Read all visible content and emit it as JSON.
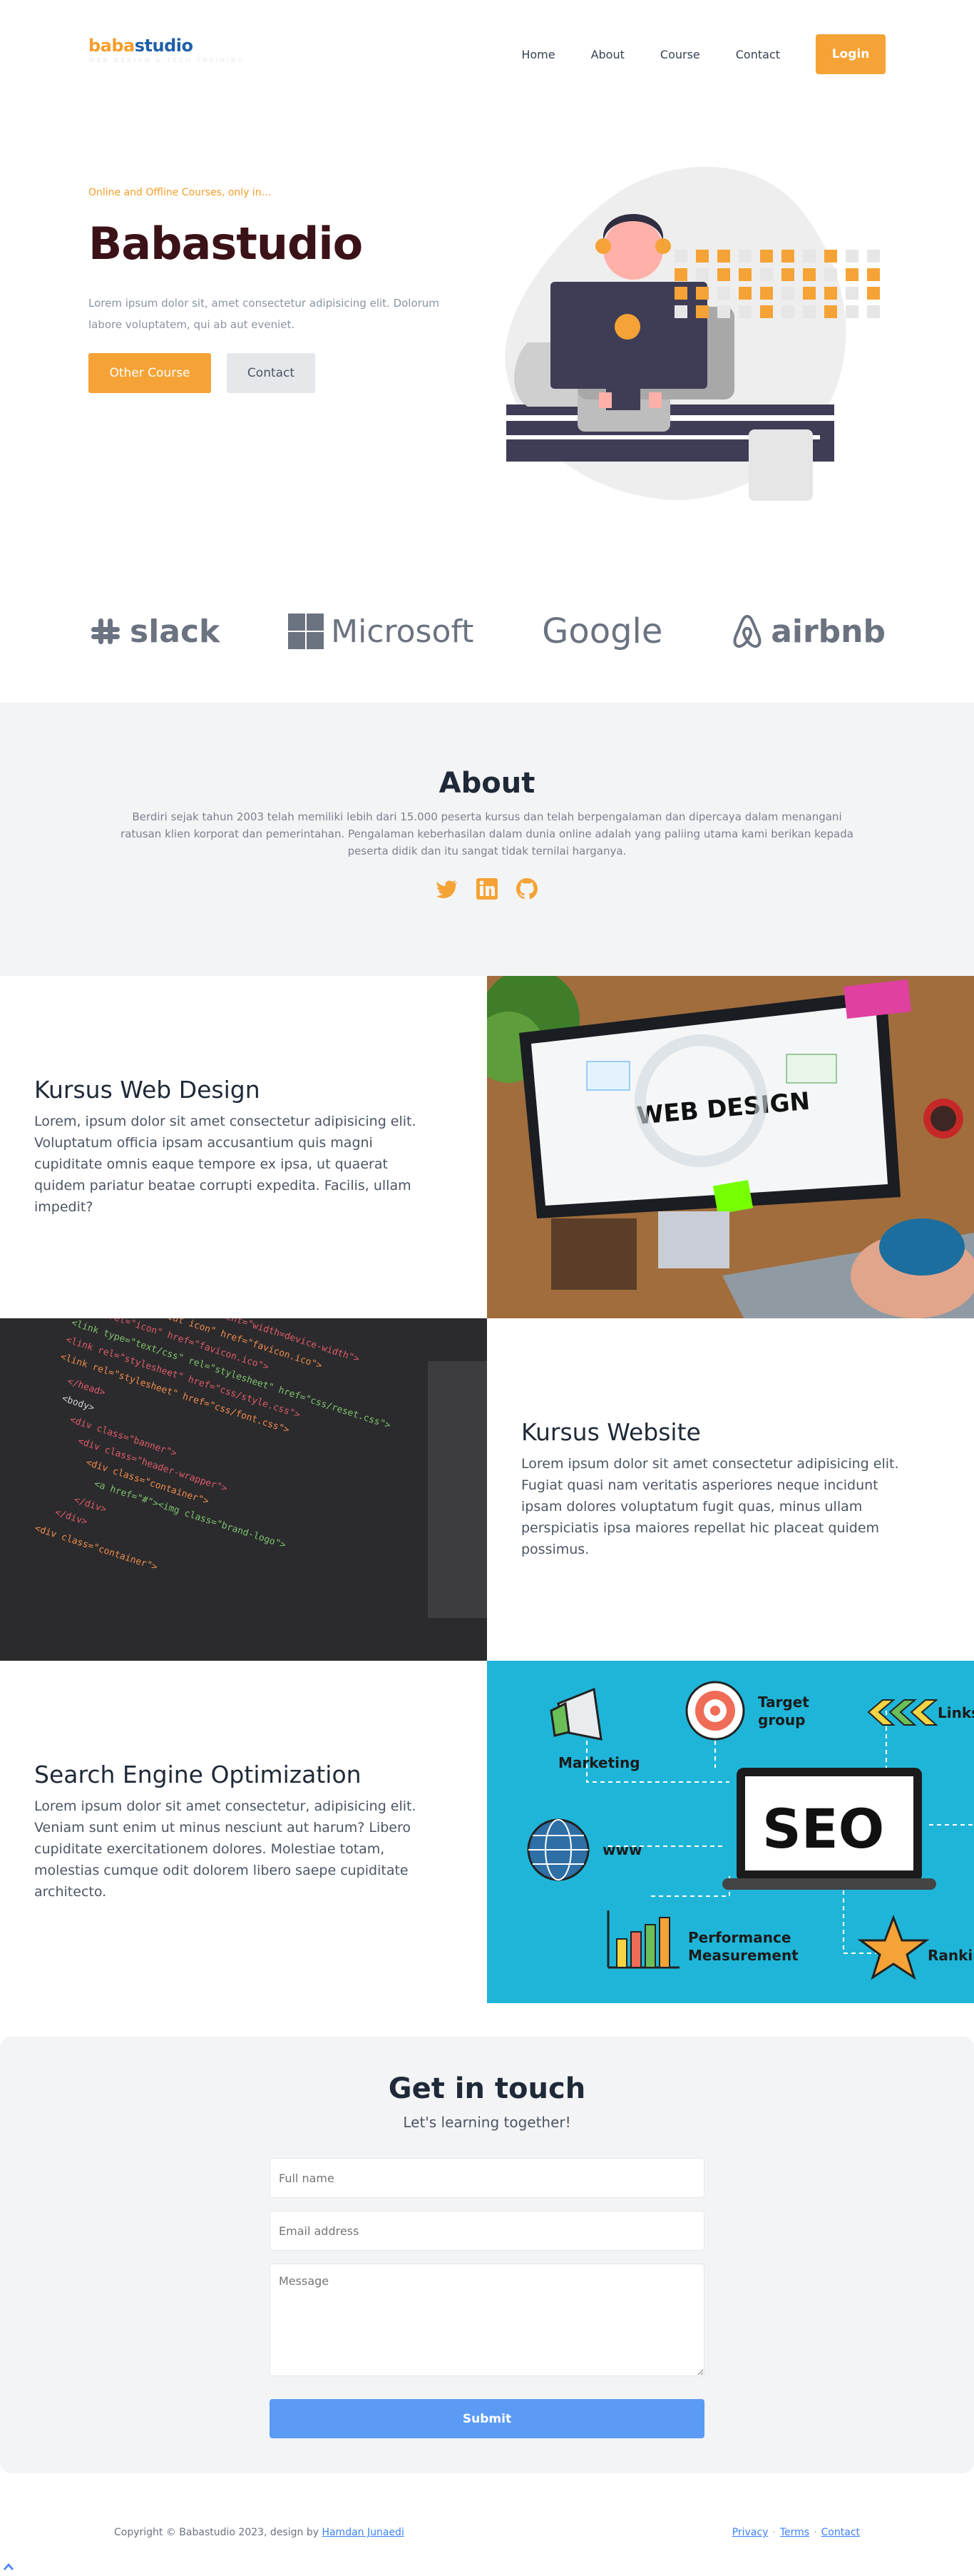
{
  "nav": {
    "logo_part1": "baba",
    "logo_part2": "studio",
    "logo_tagline": "WEB DESIGN & TECH TRAINING",
    "items": [
      "Home",
      "About",
      "Course",
      "Contact"
    ],
    "login_label": "Login"
  },
  "hero": {
    "kicker": "Online and Offline Courses, only in...",
    "title": "Babastudio",
    "description": "Lorem ipsum dolor sit, amet consectetur adipisicing elit. Dolorum labore voluptatem, qui ab aut eveniet.",
    "primary_button": "Other Course",
    "secondary_button": "Contact"
  },
  "partners": [
    "slack",
    "Microsoft",
    "Google",
    "airbnb"
  ],
  "about": {
    "title": "About",
    "text": "Berdiri sejak tahun 2003 telah memiliki lebih dari 15.000 peserta kursus dan telah berpengalaman dan dipercaya dalam menangani ratusan klien korporat dan pemerintahan. Pengalaman keberhasilan dalam dunia online adalah yang paliing utama kami berikan kepada peserta didik dan itu sangat tidak ternilai harganya.",
    "socials": [
      "twitter-icon",
      "linkedin-icon",
      "github-icon"
    ]
  },
  "courses": [
    {
      "title": "Kursus Web Design",
      "text": "Lorem, ipsum dolor sit amet consectetur adipisicing elit. Voluptatum officia ipsam accusantium quis magni cupiditate omnis eaque tempore ex ipsa, ut quaerat quidem pariatur beatae corrupti expedita. Facilis, ullam impedit?",
      "image_text": "WEB DESIGN"
    },
    {
      "title": "Kursus Website",
      "text": "Lorem ipsum dolor sit amet consectetur adipisicing elit. Fugiat quasi nam veritatis asperiores neque incidunt ipsam dolores voluptatum fugit quas, minus ullam perspiciatis ipsa maiores repellat hic placeat quidem possimus."
    },
    {
      "title": "Search Engine Optimization",
      "text": "Lorem ipsum dolor sit amet consectetur, adipisicing elit. Veniam sunt enim ut minus nesciunt aut harum? Libero cupiditate exercitationem dolores. Molestiae totam, molestias cumque odit dolorem libero saepe cupiditate architecto.",
      "image_labels": {
        "seo": "SEO",
        "target1": "Target",
        "target2": "group",
        "links": "Links",
        "marketing": "Marketing",
        "www": "www",
        "perf1": "Performance",
        "perf2": "Measurement",
        "ranking": "Ranking"
      }
    }
  ],
  "contact": {
    "title": "Get in touch",
    "subtitle": "Let's learning together!",
    "fullname_placeholder": "Full name",
    "email_placeholder": "Email address",
    "message_placeholder": "Message",
    "submit_label": "Submit"
  },
  "footer": {
    "copyright": "Copyright © Babastudio 2023, design by ",
    "author": "Hamdan Junaedi",
    "links": [
      "Privacy",
      "Terms",
      "Contact"
    ]
  },
  "colors": {
    "accent": "#f5a336",
    "title": "#3b1218",
    "brand_blue": "#1f5fa8",
    "submit": "#5b9bf5",
    "seo_bg": "#1fb5d8"
  }
}
